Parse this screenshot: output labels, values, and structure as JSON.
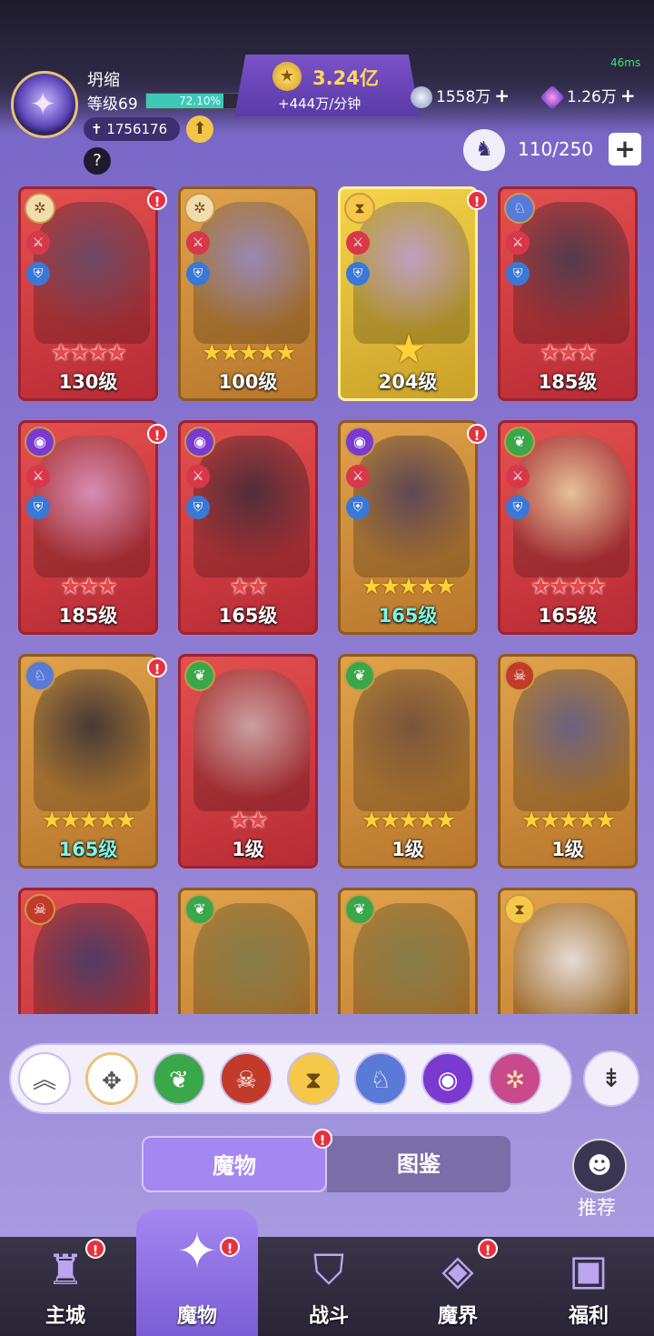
{
  "player": {
    "name": "坍缩",
    "level_label": "等级69",
    "xp_percent_text": "72.10%",
    "xp_fraction": 0.721,
    "power": "1756176",
    "upgrade_icon": "up-arrow-icon",
    "help_icon": "question-icon"
  },
  "currency": {
    "gold": "3.24亿",
    "gold_rate": "+444万/分钟",
    "silver": "1558万",
    "gems": "1.26万",
    "plus": "+"
  },
  "ping": "46ms",
  "capacity": {
    "text": "110/250",
    "plus": "+"
  },
  "cards": [
    {
      "level": "130级",
      "stars": 4,
      "star_color": "red",
      "frame": "red",
      "alert": true,
      "element": "wind"
    },
    {
      "level": "100级",
      "stars": 5,
      "star_color": "gold",
      "frame": "gold",
      "alert": false,
      "element": "wind"
    },
    {
      "level": "204级",
      "stars": 1,
      "star_color": "gold",
      "frame": "yellow",
      "alert": true,
      "element": "time"
    },
    {
      "level": "185级",
      "stars": 3,
      "star_color": "red",
      "frame": "red",
      "alert": false,
      "element": "dragon"
    },
    {
      "level": "185级",
      "stars": 3,
      "star_color": "red",
      "frame": "red",
      "alert": true,
      "element": "eye"
    },
    {
      "level": "165级",
      "stars": 2,
      "star_color": "red",
      "frame": "red",
      "alert": false,
      "element": "eye"
    },
    {
      "level": "165级",
      "stars": 5,
      "star_color": "gold",
      "frame": "gold",
      "alert": true,
      "element": "eye",
      "level_color": "cyan"
    },
    {
      "level": "165级",
      "stars": 4,
      "star_color": "red",
      "frame": "red",
      "alert": false,
      "element": "nature"
    },
    {
      "level": "165级",
      "stars": 5,
      "star_color": "gold",
      "frame": "gold",
      "alert": true,
      "element": "dragon",
      "level_color": "cyan"
    },
    {
      "level": "1级",
      "stars": 2,
      "star_color": "red",
      "frame": "red",
      "alert": false,
      "element": "nature"
    },
    {
      "level": "1级",
      "stars": 5,
      "star_color": "gold",
      "frame": "gold",
      "alert": false,
      "element": "nature"
    },
    {
      "level": "1级",
      "stars": 5,
      "star_color": "gold",
      "frame": "gold",
      "alert": false,
      "element": "demon"
    },
    {
      "level": "",
      "stars": 0,
      "star_color": "gold",
      "frame": "red",
      "alert": false,
      "element": "demon"
    },
    {
      "level": "",
      "stars": 0,
      "star_color": "gold",
      "frame": "gold",
      "alert": false,
      "element": "nature"
    },
    {
      "level": "",
      "stars": 0,
      "star_color": "gold",
      "frame": "gold",
      "alert": false,
      "element": "nature"
    },
    {
      "level": "",
      "stars": 0,
      "star_color": "gold",
      "frame": "gold",
      "alert": false,
      "element": "time"
    }
  ],
  "filters": [
    "collapse-icon",
    "all-icon",
    "nature-icon",
    "demon-icon",
    "time-icon",
    "dragon-icon",
    "eye-icon",
    "wind-icon"
  ],
  "sort_icon": "sort-icon",
  "tabs": {
    "monsters": "魔物",
    "codex": "图鉴"
  },
  "recommend": "推荐",
  "nav": [
    {
      "label": "主城",
      "icon": "castle-icon"
    },
    {
      "label": "魔物",
      "icon": "monster-icon"
    },
    {
      "label": "战斗",
      "icon": "battle-icon"
    },
    {
      "label": "魔界",
      "icon": "portal-icon"
    },
    {
      "label": "福利",
      "icon": "chest-icon"
    }
  ],
  "colors": {
    "accent": "#a487f0",
    "gold": "#ffd85a",
    "alert": "#e8313f"
  }
}
